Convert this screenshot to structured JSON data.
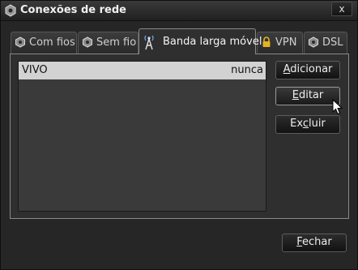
{
  "window": {
    "title": "Conexões de rede",
    "close_label": "x"
  },
  "tabs": [
    {
      "label": "Com fios",
      "icon": "network-icon",
      "active": false
    },
    {
      "label": "Sem fio",
      "icon": "network-icon",
      "active": false
    },
    {
      "label": "Banda larga móvel",
      "icon": "antenna-icon",
      "active": true
    },
    {
      "label": "VPN",
      "icon": "lock-icon",
      "active": false
    },
    {
      "label": "DSL",
      "icon": "network-icon",
      "active": false
    }
  ],
  "connections": [
    {
      "name": "VIVO",
      "last_used": "nunca",
      "selected": true
    }
  ],
  "buttons": {
    "add": {
      "pre": "",
      "mnemonic": "A",
      "post": "dicionar"
    },
    "edit": {
      "pre": "",
      "mnemonic": "E",
      "post": "ditar"
    },
    "delete": {
      "pre": "Ex",
      "mnemonic": "c",
      "post": "luir"
    },
    "close": {
      "pre": "",
      "mnemonic": "F",
      "post": "echar"
    }
  },
  "colors": {
    "background": "#262626",
    "selection": "#d2d2d2",
    "tab_border_active": "#8a8a8a",
    "lock": "#e6b422"
  }
}
